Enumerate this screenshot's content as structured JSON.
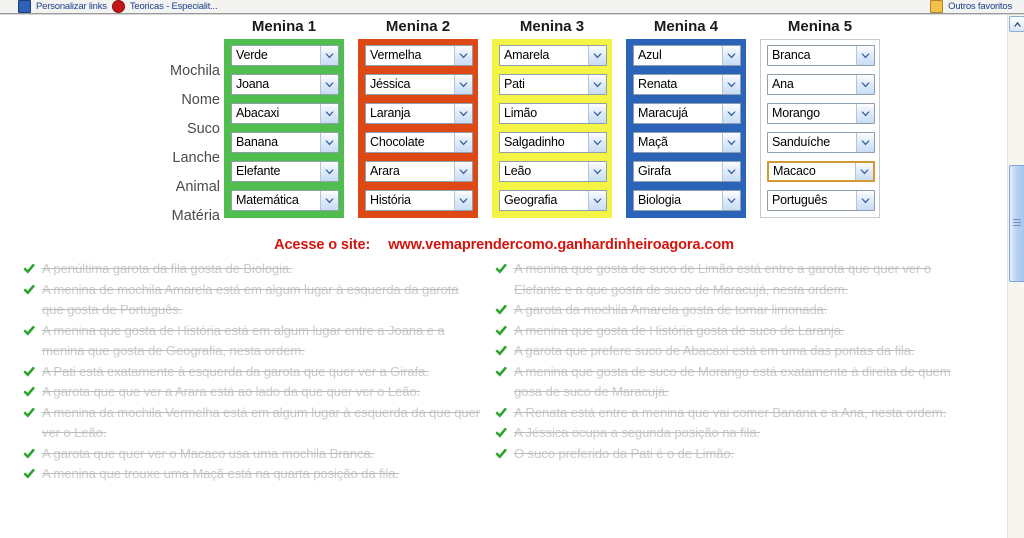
{
  "browser_chrome": {
    "left_items": [
      {
        "icon": "window-blue-icon",
        "label": "Personalizar links"
      },
      {
        "icon": "record-red-icon",
        "label": "Teoricas - Especialit..."
      }
    ],
    "right_items": [
      {
        "icon": "folder-yellow-icon",
        "label": "Outros favoritos"
      }
    ]
  },
  "scrollbar": {
    "up_arrow": "scroll-up-icon",
    "thumb_grip": "scrollbar-grip-icon"
  },
  "grid": {
    "row_labels": [
      "Mochila",
      "Nome",
      "Suco",
      "Lanche",
      "Animal",
      "Matéria"
    ],
    "columns": [
      {
        "header": "Menina 1",
        "color": "#4fbe4f",
        "border": "#4fbe4f",
        "values": [
          "Verde",
          "Joana",
          "Abacaxi",
          "Banana",
          "Elefante",
          "Matemática"
        ],
        "focused_index": -1
      },
      {
        "header": "Menina 2",
        "color": "#dd4814",
        "border": "#dd4814",
        "values": [
          "Vermelha",
          "Jéssica",
          "Laranja",
          "Chocolate",
          "Arara",
          "História"
        ],
        "focused_index": -1
      },
      {
        "header": "Menina 3",
        "color": "#f4f444",
        "border": "#f4f444",
        "values": [
          "Amarela",
          "Pati",
          "Limão",
          "Salgadinho",
          "Leão",
          "Geografia"
        ],
        "focused_index": -1
      },
      {
        "header": "Menina 4",
        "color": "#2a63b8",
        "border": "#2a63b8",
        "values": [
          "Azul",
          "Renata",
          "Maracujá",
          "Maçã",
          "Girafa",
          "Biologia"
        ],
        "focused_index": -1
      },
      {
        "header": "Menina 5",
        "color": "#ffffff",
        "border": "#c9c9c9",
        "values": [
          "Branca",
          "Ana",
          "Morango",
          "Sanduíche",
          "Macaco",
          "Português"
        ],
        "focused_index": 4
      }
    ]
  },
  "site": {
    "label": "Acesse o site:",
    "url": "www.vemaprendercomo.ganhardinheiroagora.com",
    "color": "#d4130c"
  },
  "clues": {
    "check_icon": "green-check-icon",
    "left": [
      "A penúltima garota da fila gosta de Biologia.",
      "A menina de mochila Amarela está em algum lugar à esquerda da garota que gosta de Português.",
      "A menina que gosta de História está em algum lugar entre a Joana e a menina que gosta de Geografia, nesta ordem.",
      "A Pati está exatamente à esquerda da garota que quer ver a Girafa.",
      "A garota que que ver a Arara está ao lado da que quer ver o Leão.",
      "A menina da mochila Vermelha está em algum lugar à esquerda da que quer ver o Leão.",
      "A garota que quer ver o Macaco usa uma mochila Branca.",
      "A menina que trouxe uma Maçã está na quarta posição da fila."
    ],
    "right": [
      "A menina que gosta de suco de Limão está entre a garota que quer ver o Elefante e a que gosta de suco de Maracujá, nesta ordem.",
      "A garota da mochila Amarela gosta de tomar limonada.",
      "A menina que gosta de História gosta de suco de Laranja.",
      "A garota que prefere suco de Abacaxi está em uma das pontas da fila.",
      "A menina que gosta de suco de Morango está exatamente à direita de quem gosa de suco de Maracujá.",
      "A Renata está entre a menina que vai comer Banana e a Ana, nesta ordem.",
      "A Jéssica ocupa a segunda posição na fila.",
      "O suco preferido da Pati é o de Limão."
    ]
  }
}
